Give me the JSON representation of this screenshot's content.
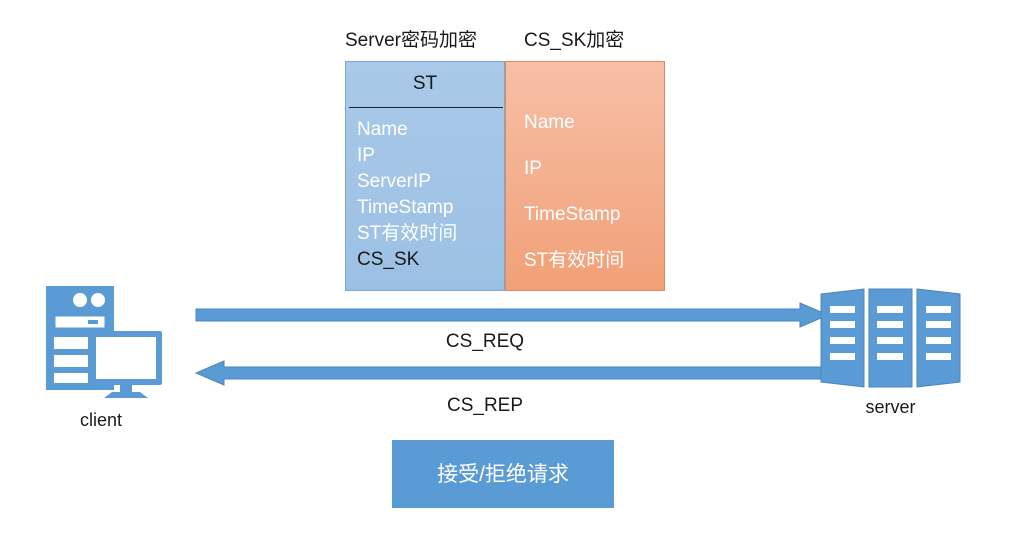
{
  "diagram": {
    "captions": {
      "st_box": "Server密码加密",
      "cssk_box": "CS_SK加密"
    },
    "st_box": {
      "title": "ST",
      "fields": [
        {
          "label": "Name",
          "style": "light"
        },
        {
          "label": "IP",
          "style": "light"
        },
        {
          "label": "ServerIP",
          "style": "light"
        },
        {
          "label": "TimeStamp",
          "style": "light"
        },
        {
          "label": "ST有效时间",
          "style": "light"
        },
        {
          "label": "CS_SK",
          "style": "dark"
        }
      ],
      "fill_color": "#9cc0e4",
      "border_color": "#7aa8d0"
    },
    "cssk_box": {
      "fields": [
        {
          "label": "Name"
        },
        {
          "label": "IP"
        },
        {
          "label": "TimeStamp"
        },
        {
          "label": "ST有效时间"
        }
      ],
      "fill_color": "#f1a077",
      "border_color": "#e08a5a"
    },
    "nodes": {
      "client": {
        "label": "client",
        "icon": "desktop-computer-icon"
      },
      "server": {
        "label": "server",
        "icon": "server-rack-icon"
      }
    },
    "arrows": [
      {
        "id": "cs-req",
        "label": "CS_REQ",
        "direction": "client-to-server",
        "color": "#5b9bd5"
      },
      {
        "id": "cs-rep",
        "label": "CS_REP",
        "direction": "server-to-client",
        "color": "#5b9bd5"
      }
    ],
    "result_box": {
      "label": "接受/拒绝请求",
      "fill_color": "#5b9bd5",
      "text_color": "#ffffff"
    }
  }
}
